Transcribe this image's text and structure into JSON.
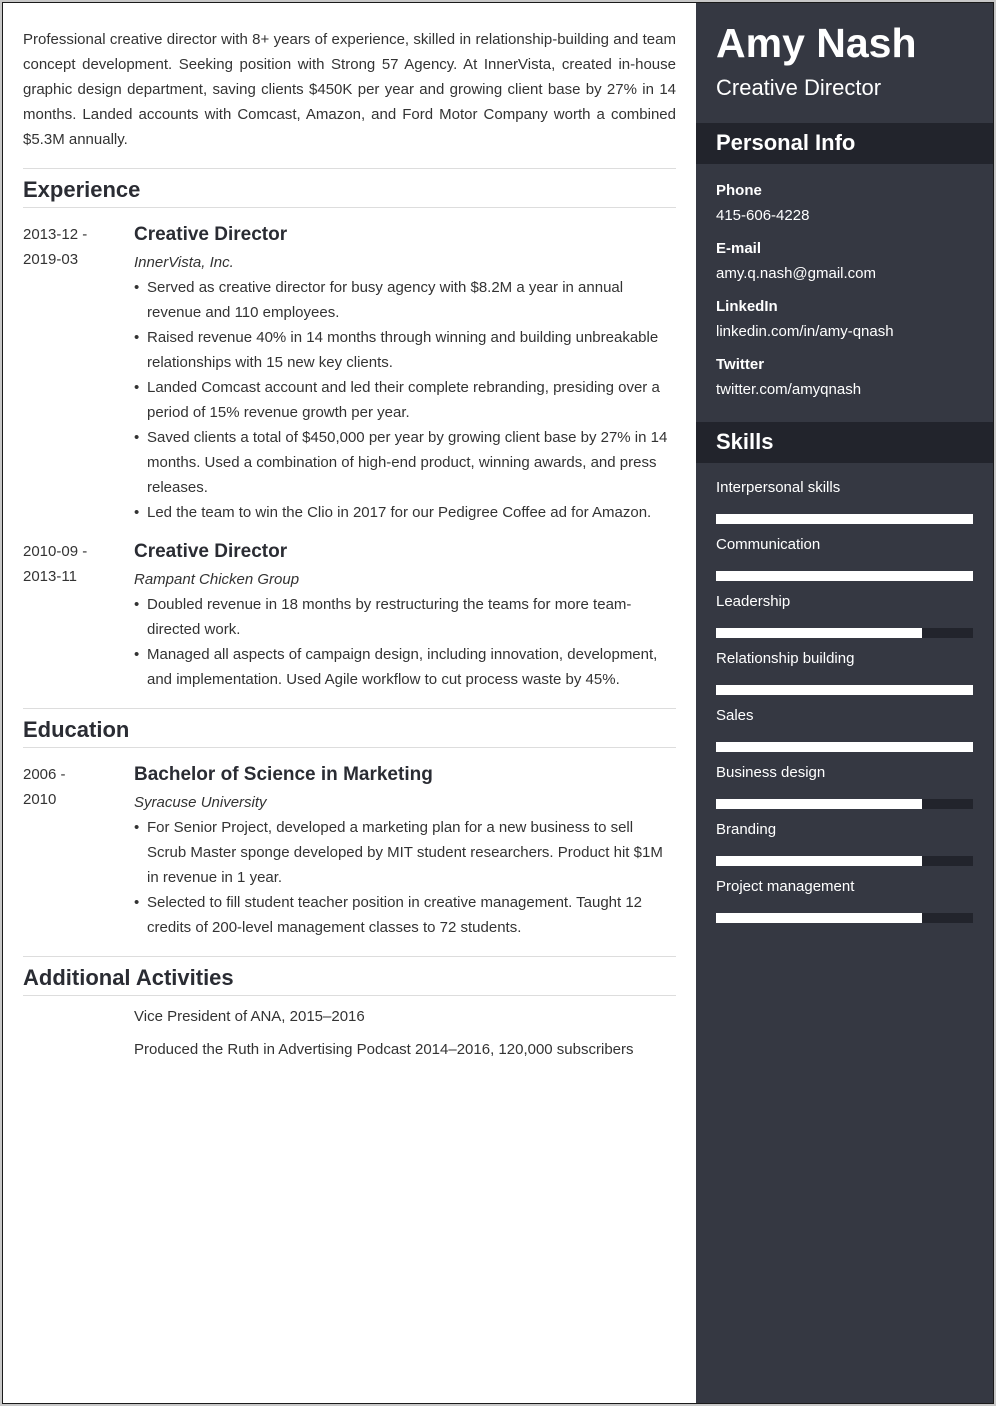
{
  "summary": "Professional creative director with 8+ years of experience, skilled in relationship-building and team concept development. Seeking position with Strong 57 Agency. At InnerVista, created in-house graphic design department, saving clients $450K per year and growing client base by 27% in 14 months. Landed accounts with Comcast, Amazon, and Ford Motor Company worth a combined $5.3M annually.",
  "experience": {
    "heading": "Experience",
    "entries": [
      {
        "date_start": "2013-12 -",
        "date_end": "2019-03",
        "title": "Creative Director",
        "org": "InnerVista, Inc.",
        "bullets": [
          "Served as creative director for busy agency with $8.2M a year in annual revenue and 110 employees.",
          "Raised revenue 40% in 14 months through winning and building unbreakable relationships with 15 new key clients.",
          "Landed Comcast account and led their complete rebranding, presiding over a period of 15% revenue growth per year.",
          "Saved clients a total of $450,000 per year by growing client base by 27% in 14 months. Used a combination of high-end product, winning awards, and press releases.",
          "Led the team to win the Clio in 2017 for our Pedigree Coffee ad for Amazon."
        ]
      },
      {
        "date_start": "2010-09 -",
        "date_end": "2013-11",
        "title": "Creative Director",
        "org": "Rampant Chicken Group",
        "bullets": [
          "Doubled revenue in 18 months by restructuring the teams for more team-directed work.",
          "Managed all aspects of campaign design, including innovation, development, and implementation. Used Agile workflow to cut process waste by 45%."
        ]
      }
    ]
  },
  "education": {
    "heading": "Education",
    "entries": [
      {
        "date_start": "2006 -",
        "date_end": "2010",
        "title": "Bachelor of Science in Marketing",
        "org": "Syracuse University",
        "bullets": [
          "For Senior Project, developed a marketing plan for a new business to sell Scrub Master sponge developed by MIT student researchers. Product hit $1M in revenue in 1 year.",
          "Selected to fill student teacher position in creative management. Taught 12 credits of 200-level management classes to 72 students."
        ]
      }
    ]
  },
  "activities": {
    "heading": "Additional Activities",
    "items": [
      "Vice President of ANA, 2015–2016",
      "Produced the Ruth in Advertising Podcast 2014–2016, 120,000 subscribers"
    ]
  },
  "sidebar": {
    "name": "Amy Nash",
    "role": "Creative Director",
    "personal_heading": "Personal Info",
    "personal": [
      {
        "label": "Phone",
        "value": "415-606-4228"
      },
      {
        "label": "E-mail",
        "value": "amy.q.nash@gmail.com"
      },
      {
        "label": "LinkedIn",
        "value": "linkedin.com/in/amy-qnash"
      },
      {
        "label": "Twitter",
        "value": "twitter.com/amyqnash"
      }
    ],
    "skills_heading": "Skills",
    "skills": [
      {
        "name": "Interpersonal skills",
        "level": 1.0
      },
      {
        "name": "Communication",
        "level": 1.0
      },
      {
        "name": "Leadership",
        "level": 0.8
      },
      {
        "name": "Relationship building",
        "level": 1.0
      },
      {
        "name": "Sales",
        "level": 1.0
      },
      {
        "name": "Business design",
        "level": 0.8
      },
      {
        "name": "Branding",
        "level": 0.8
      },
      {
        "name": "Project management",
        "level": 0.8
      }
    ]
  },
  "colors": {
    "sidebar_bg": "#353842",
    "sidebar_header_bg": "#22242c",
    "bar_fill": "#ffffff"
  }
}
